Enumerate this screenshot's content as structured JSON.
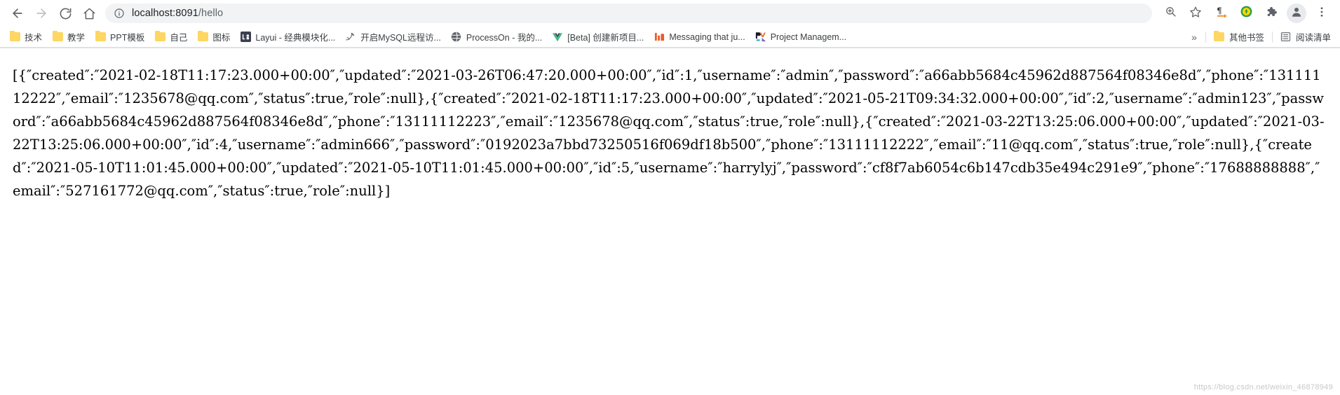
{
  "toolbar": {
    "back_icon": "back-arrow-icon",
    "forward_icon": "forward-arrow-icon",
    "reload_icon": "reload-icon",
    "home_icon": "home-icon",
    "info_icon": "page-info-icon",
    "url_host": "localhost:8091",
    "url_path": "/hello",
    "url_full": "localhost:8091/hello",
    "zoom_icon": "zoom-magnifier-icon",
    "bookmark_icon": "star-icon",
    "translate_icon": "pilcrow-translate-icon",
    "extension_circle_icon": "circle-extension-icon",
    "puzzle_icon": "puzzle-extensions-icon",
    "profile_icon": "profile-avatar-icon",
    "menu_icon": "three-dot-menu-icon"
  },
  "bookmarks": {
    "items": [
      {
        "label": "技术",
        "icon": "folder-icon"
      },
      {
        "label": "教学",
        "icon": "folder-icon"
      },
      {
        "label": "PPT模板",
        "icon": "folder-icon"
      },
      {
        "label": "自己",
        "icon": "folder-icon"
      },
      {
        "label": "图标",
        "icon": "folder-icon"
      },
      {
        "label": "Layui - 经典模块化...",
        "icon": "layui-icon"
      },
      {
        "label": "开启MySQL远程访...",
        "icon": "mysql-dolphin-icon"
      },
      {
        "label": "ProcessOn - 我的...",
        "icon": "processon-icon"
      },
      {
        "label": "[Beta] 创建新项目...",
        "icon": "vue-icon"
      },
      {
        "label": "Messaging that ju...",
        "icon": "messaging-icon"
      },
      {
        "label": "Project Managem...",
        "icon": "pm-icon"
      }
    ],
    "overflow_label": "»",
    "other_bookmarks_label": "其他书签",
    "other_bookmarks_icon": "folder-icon",
    "reading_list_label": "阅读清单",
    "reading_list_icon": "reading-list-icon"
  },
  "response": {
    "raw": "[{″created″:″2021-02-18T11:17:23.000+00:00″,″updated″:″2021-03-26T06:47:20.000+00:00″,″id″:1,″username″:″admin″,″password″:″a66abb5684c45962d887564f08346e8d″,″phone″:″13111112222″,″email″:″1235678@qq.com″,″status″:true,″role″:null},{″created″:″2021-02-18T11:17:23.000+00:00″,″updated″:″2021-05-21T09:34:32.000+00:00″,″id″:2,″username″:″admin123″,″password″:″a66abb5684c45962d887564f08346e8d″,″phone″:″13111112223″,″email″:″1235678@qq.com″,″status″:true,″role″:null},{″created″:″2021-03-22T13:25:06.000+00:00″,″updated″:″2021-03-22T13:25:06.000+00:00″,″id″:4,″username″:″admin666″,″password″:″0192023a7bbd73250516f069df18b500″,″phone″:″13111112222″,″email″:″11@qq.com″,″status″:true,″role″:null},{″created″:″2021-05-10T11:01:45.000+00:00″,″updated″:″2021-05-10T11:01:45.000+00:00″,″id″:5,″username″:″harrylyj″,″password″:″cf8f7ab6054c6b147cdb35e494c291e9″,″phone″:″17688888888″,″email″:″527161772@qq.com″,″status″:true,″role″:null}]",
    "records": [
      {
        "created": "2021-02-18T11:17:23.000+00:00",
        "updated": "2021-03-26T06:47:20.000+00:00",
        "id": 1,
        "username": "admin",
        "password": "a66abb5684c45962d887564f08346e8d",
        "phone": "13111112222",
        "email": "1235678@qq.com",
        "status": true,
        "role": null
      },
      {
        "created": "2021-02-18T11:17:23.000+00:00",
        "updated": "2021-05-21T09:34:32.000+00:00",
        "id": 2,
        "username": "admin123",
        "password": "a66abb5684c45962d887564f08346e8d",
        "phone": "13111112223",
        "email": "1235678@qq.com",
        "status": true,
        "role": null
      },
      {
        "created": "2021-03-22T13:25:06.000+00:00",
        "updated": "2021-03-22T13:25:06.000+00:00",
        "id": 4,
        "username": "admin666",
        "password": "0192023a7bbd73250516f069df18b500",
        "phone": "13111112222",
        "email": "11@qq.com",
        "status": true,
        "role": null
      },
      {
        "created": "2021-05-10T11:01:45.000+00:00",
        "updated": "2021-05-10T11:01:45.000+00:00",
        "id": 5,
        "username": "harrylyj",
        "password": "cf8f7ab6054c6b147cdb35e494c291e9",
        "phone": "17688888888",
        "email": "527161772@qq.com",
        "status": true,
        "role": null
      }
    ]
  },
  "watermark": "https://blog.csdn.net/weixin_46878949"
}
